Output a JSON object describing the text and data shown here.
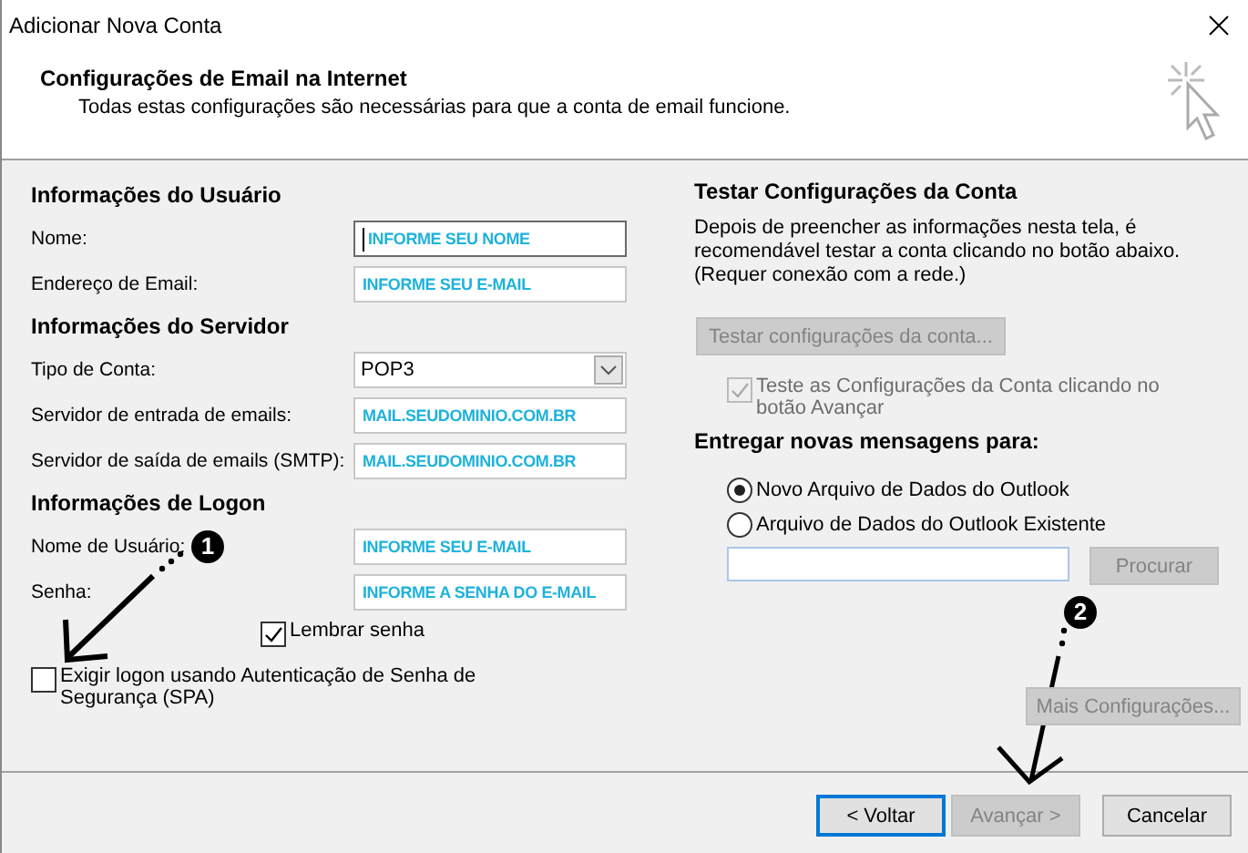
{
  "window": {
    "title": "Adicionar Nova Conta"
  },
  "header": {
    "title": "Configurações de Email na Internet",
    "subtitle": "Todas estas configurações são necessárias para que a conta de email funcione."
  },
  "left_sections": [
    {
      "heading": "Informações do Usuário",
      "fields": [
        {
          "kind": "text",
          "label": "Nome:",
          "value": "INFORME SEU NOME",
          "focused": true
        },
        {
          "kind": "text",
          "label": "Endereço de Email:",
          "value": "INFORME SEU E-MAIL",
          "focused": false
        }
      ]
    },
    {
      "heading": "Informações do Servidor",
      "fields": [
        {
          "kind": "dropdown",
          "label": "Tipo de Conta:",
          "value": "POP3",
          "focused": false
        },
        {
          "kind": "text",
          "label": "Servidor de entrada de emails:",
          "value": "MAIL.SEUDOMINIO.COM.BR",
          "focused": false
        },
        {
          "kind": "text",
          "label": "Servidor de saída de emails (SMTP):",
          "value": "MAIL.SEUDOMINIO.COM.BR",
          "focused": false
        }
      ]
    },
    {
      "heading": "Informações de Logon",
      "fields": [
        {
          "kind": "text",
          "label": "Nome de Usuário:",
          "value": "INFORME SEU E-MAIL",
          "focused": false
        },
        {
          "kind": "text",
          "label": "Senha:",
          "value": "INFORME A SENHA DO E-MAIL",
          "focused": false
        }
      ]
    }
  ],
  "remember_password": {
    "label": "Lembrar senha",
    "checked": true
  },
  "spa": {
    "label": "Exigir logon usando Autenticação de Senha de Segurança (SPA)",
    "checked": false
  },
  "test": {
    "heading": "Testar Configurações da Conta",
    "description": "Depois de preencher as informações nesta tela, é recomendável testar a conta clicando no botão abaixo. (Requer conexão com a rede.)",
    "button": {
      "label": "Testar configurações da conta...",
      "disabled": true
    },
    "checkbox": {
      "label": "Teste as Configurações da Conta clicando no botão Avançar",
      "checked": true,
      "disabled": true
    }
  },
  "deliver": {
    "heading": "Entregar novas mensagens para:",
    "options": [
      {
        "label": "Novo Arquivo de Dados do Outlook",
        "selected": true
      },
      {
        "label": "Arquivo de Dados do Outlook Existente",
        "selected": false
      }
    ],
    "browse_button": {
      "label": "Procurar",
      "disabled": true
    }
  },
  "more_button": {
    "label": "Mais Configurações...",
    "disabled": true
  },
  "footer_buttons": [
    {
      "label": "< Voltar",
      "disabled": false,
      "default": true
    },
    {
      "label": "Avançar >",
      "disabled": true,
      "default": false
    },
    {
      "label": "Cancelar",
      "disabled": false,
      "default": false
    }
  ],
  "annotations": [
    {
      "number": "1"
    },
    {
      "number": "2"
    }
  ]
}
